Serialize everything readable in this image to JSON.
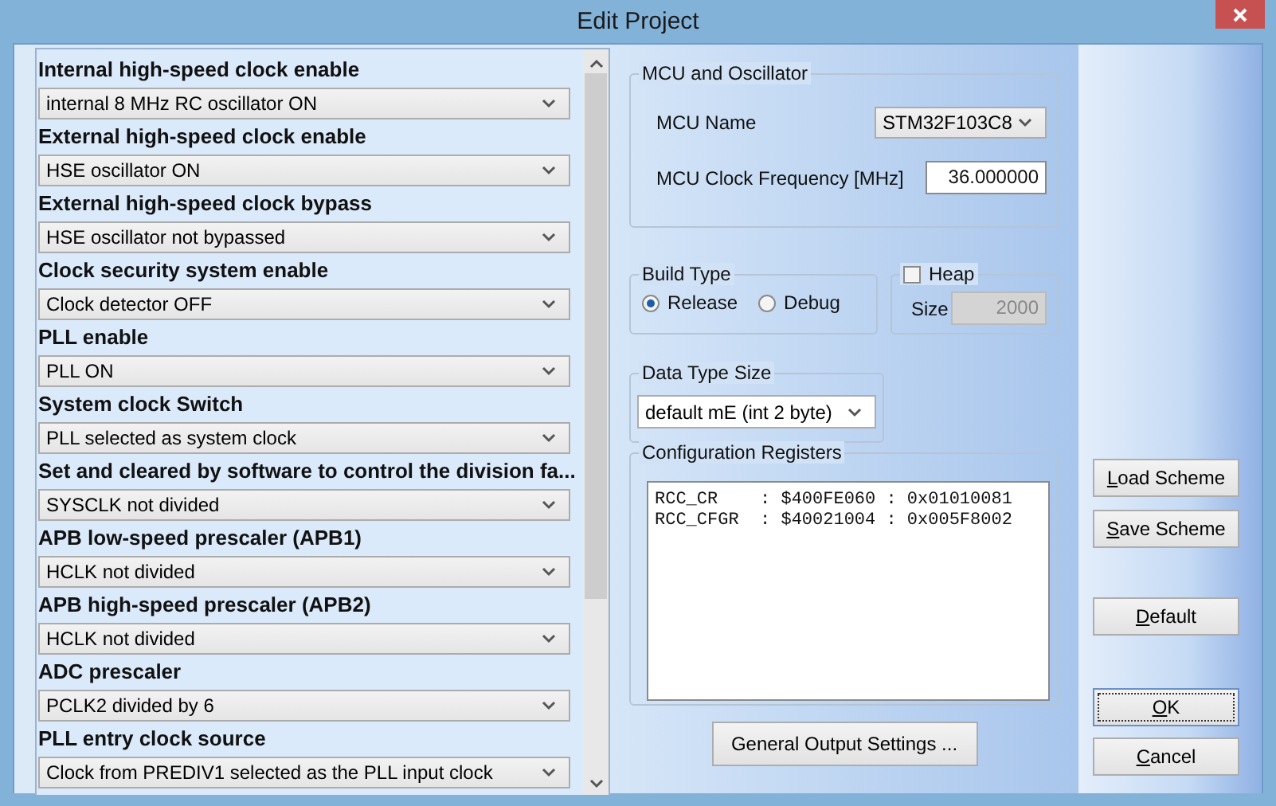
{
  "window": {
    "title": "Edit Project"
  },
  "settings": [
    {
      "label": "Internal high-speed clock enable",
      "value": "internal 8 MHz RC oscillator ON"
    },
    {
      "label": "External high-speed clock enable",
      "value": "HSE oscillator ON"
    },
    {
      "label": "External high-speed clock bypass",
      "value": "HSE oscillator not bypassed"
    },
    {
      "label": "Clock security system enable",
      "value": "Clock detector OFF"
    },
    {
      "label": "PLL enable",
      "value": "PLL ON"
    },
    {
      "label": "System clock Switch",
      "value": "PLL selected as system clock"
    },
    {
      "label": "Set and cleared by software to control the division fa...",
      "value": "SYSCLK not divided"
    },
    {
      "label": "APB low-speed prescaler (APB1)",
      "value": "HCLK not divided"
    },
    {
      "label": "APB high-speed prescaler (APB2)",
      "value": "HCLK not divided"
    },
    {
      "label": "ADC prescaler",
      "value": "PCLK2 divided by 6"
    },
    {
      "label": "PLL entry clock source",
      "value": "Clock from PREDIV1 selected as the PLL input clock"
    }
  ],
  "mcu_and_oscillator": {
    "title": "MCU and Oscillator",
    "mcu_name_label": "MCU Name",
    "mcu_name": "STM32F103C8",
    "clock_label": "MCU Clock Frequency [MHz]",
    "clock_value": "36.000000"
  },
  "build_type": {
    "title": "Build Type",
    "options": [
      {
        "label": "Release",
        "selected": true
      },
      {
        "label": "Debug",
        "selected": false
      }
    ]
  },
  "heap": {
    "label": "Heap",
    "checked": false,
    "size_label": "Size",
    "size_value": "2000",
    "size_disabled": true
  },
  "data_type_size": {
    "title": "Data Type Size",
    "value": "default mE (int 2 byte)"
  },
  "configuration_registers": {
    "title": "Configuration Registers",
    "lines": [
      "RCC_CR    : $400FE060 : 0x01010081",
      "RCC_CFGR  : $40021004 : 0x005F8002"
    ]
  },
  "general_output_button": "General Output Settings ...",
  "side_buttons": [
    {
      "label": "Load Scheme",
      "focused": false
    },
    {
      "label": "Save Scheme",
      "focused": false
    },
    {
      "label": "Default",
      "focused": false
    },
    {
      "label": "OK",
      "focused": true
    },
    {
      "label": "Cancel",
      "focused": false
    }
  ]
}
